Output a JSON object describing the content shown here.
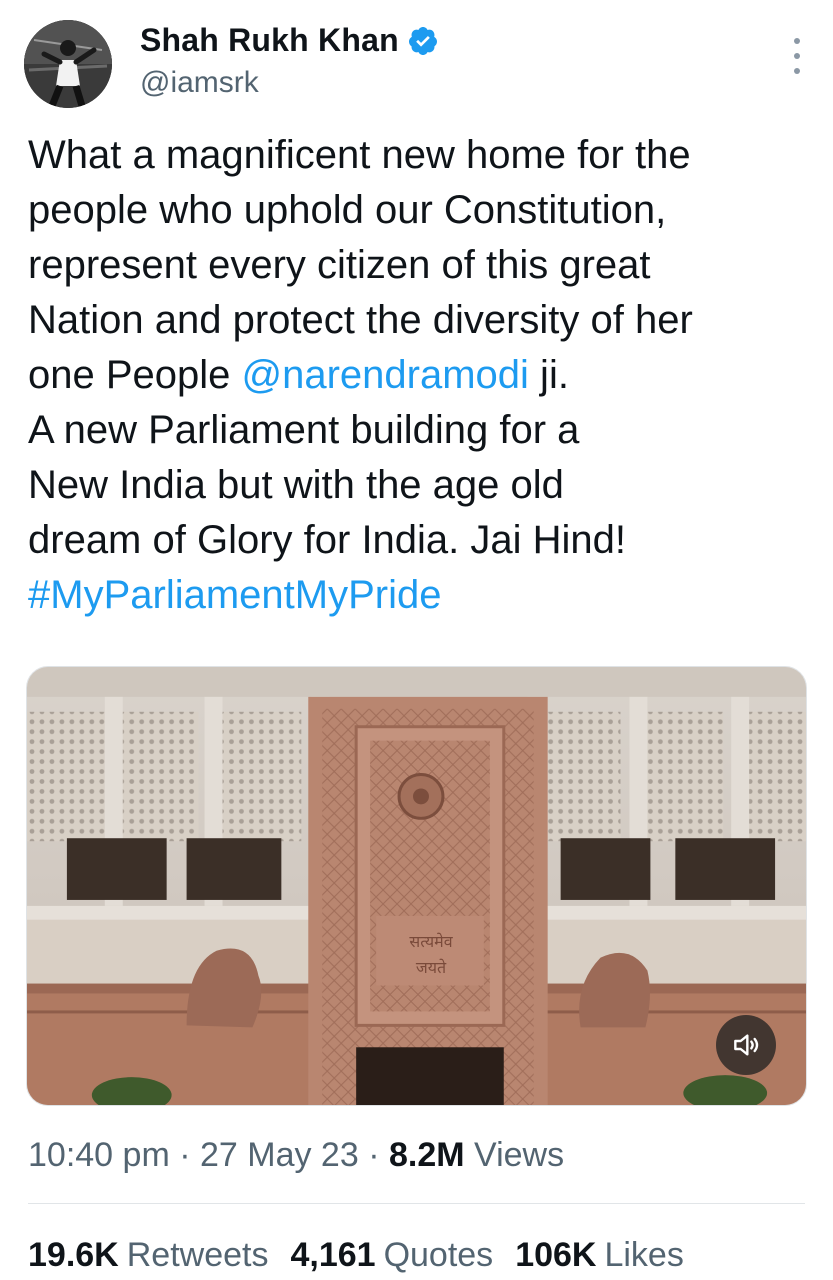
{
  "author": {
    "display_name": "Shah Rukh Khan",
    "handle": "@iamsrk"
  },
  "tweet": {
    "lines": [
      {
        "text": "What a magnificent new home for the"
      },
      {
        "text": "people who uphold our Constitution,"
      },
      {
        "text": "represent every citizen of this great"
      },
      {
        "text": "Nation and protect the diversity of her"
      },
      {
        "pre": "one People ",
        "mention": "@narendramodi",
        "post": " ji."
      },
      {
        "text": "A new Parliament building for a"
      },
      {
        "text": "New India but with the age old"
      },
      {
        "text": "dream of Glory for India. Jai Hind!"
      }
    ],
    "hashtag": "#MyParliamentMyPride"
  },
  "media": {
    "plaque_line1": "सत्यमेव",
    "plaque_line2": "जयते"
  },
  "meta": {
    "time": "10:40 pm",
    "sep1": " · ",
    "date": "27 May 23",
    "sep2": " · ",
    "views_count": "8.2M",
    "views_label": " Views"
  },
  "stats": {
    "retweets_count": "19.6K",
    "retweets_label": "Retweets",
    "quotes_count": "4,161",
    "quotes_label": "Quotes",
    "likes_count": "106K",
    "likes_label": "Likes"
  },
  "colors": {
    "link": "#1d9bf0",
    "secondary_text": "#536471",
    "sandstone": "#b07a62"
  }
}
